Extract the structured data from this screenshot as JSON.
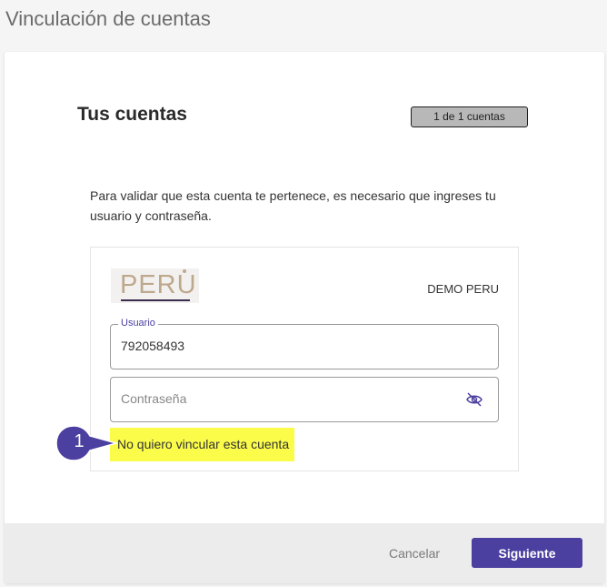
{
  "page": {
    "title": "Vinculación de cuentas"
  },
  "dialog": {
    "title": "Tus cuentas",
    "counter": "1 de 1 cuentas",
    "instructions": "Para validar que esta cuenta te pertenece, es necesario que ingreses tu usuario y contraseña."
  },
  "account": {
    "bank_logo_text": "PERU",
    "name": "DEMO PERU",
    "username": {
      "label": "Usuario",
      "value": "792058493"
    },
    "password": {
      "placeholder": "Contraseña",
      "toggle_icon": "eye-off-icon"
    },
    "skip_link": "No quiero vincular esta cuenta"
  },
  "callout": {
    "number": "1",
    "color": "#4b3fa0"
  },
  "footer": {
    "cancel_label": "Cancelar",
    "next_label": "Siguiente"
  },
  "colors": {
    "accent": "#4b3fa0",
    "highlight": "#fbfc4a",
    "logo": "#bda88d"
  }
}
